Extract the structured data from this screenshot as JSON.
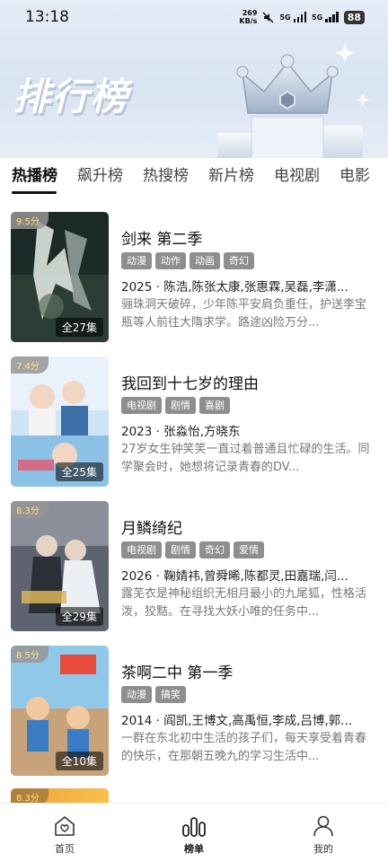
{
  "status": {
    "time": "13:18",
    "net_speed_value": "269",
    "net_speed_unit": "KB/s",
    "network_label_1": "5G",
    "network_label_2": "5G",
    "battery": "88"
  },
  "header": {
    "title": "排行榜"
  },
  "tabs": [
    {
      "label": "热播榜",
      "active": true
    },
    {
      "label": "飙升榜"
    },
    {
      "label": "热搜榜"
    },
    {
      "label": "新片榜"
    },
    {
      "label": "电视剧"
    },
    {
      "label": "电影"
    }
  ],
  "items": [
    {
      "score": "9.5分",
      "episodes": "全27集",
      "title": "剑来 第二季",
      "tags": [
        "动漫",
        "动作",
        "动画",
        "奇幻"
      ],
      "meta": "2025 · 陈浩,陈张太康,张惠霖,吴磊,李潇...",
      "desc": "骊珠洞天破碎，少年陈平安肩负重任，护送李宝瓶等人前往大隋求学。路途凶险万分..."
    },
    {
      "score": "7.4分",
      "episodes": "全25集",
      "title": "我回到十七岁的理由",
      "tags": [
        "电视剧",
        "剧情",
        "喜剧"
      ],
      "meta": "2023 · 张淼怡,方晓东",
      "desc": "27岁女生钟笑笑一直过着普通且忙碌的生活。同学聚会时，她想将记录青春的DV..."
    },
    {
      "score": "8.3分",
      "episodes": "全29集",
      "title": "月鳞绮纪",
      "tags": [
        "电视剧",
        "剧情",
        "奇幻",
        "爱情"
      ],
      "meta": "2026 · 鞠婧祎,曾舜晞,陈都灵,田嘉瑞,闫...",
      "desc": "露芜衣是神秘组织无相月最小的九尾狐，性格活泼，狡黠。在寻找大妖小唯的任务中..."
    },
    {
      "score": "8.5分",
      "episodes": "全10集",
      "title": "茶啊二中 第一季",
      "tags": [
        "动漫",
        "搞笑"
      ],
      "meta": "2014 · 阎凯,王博文,高禹恒,李成,吕博,郭...",
      "desc": "一群在东北初中生活的孩子们，每天享受着青春的快乐，在那朝五晚九的学习生活中..."
    },
    {
      "score": "8.3分"
    }
  ],
  "bottom_nav": [
    {
      "label": "首页",
      "icon": "home-icon"
    },
    {
      "label": "榜单",
      "icon": "ranking-icon",
      "active": true
    },
    {
      "label": "我的",
      "icon": "profile-icon"
    }
  ],
  "colors": {
    "accent": "#111111",
    "tag_bg": "#8e8e8e",
    "score": "#ffe07a",
    "header_bg": "#dde7f3"
  }
}
